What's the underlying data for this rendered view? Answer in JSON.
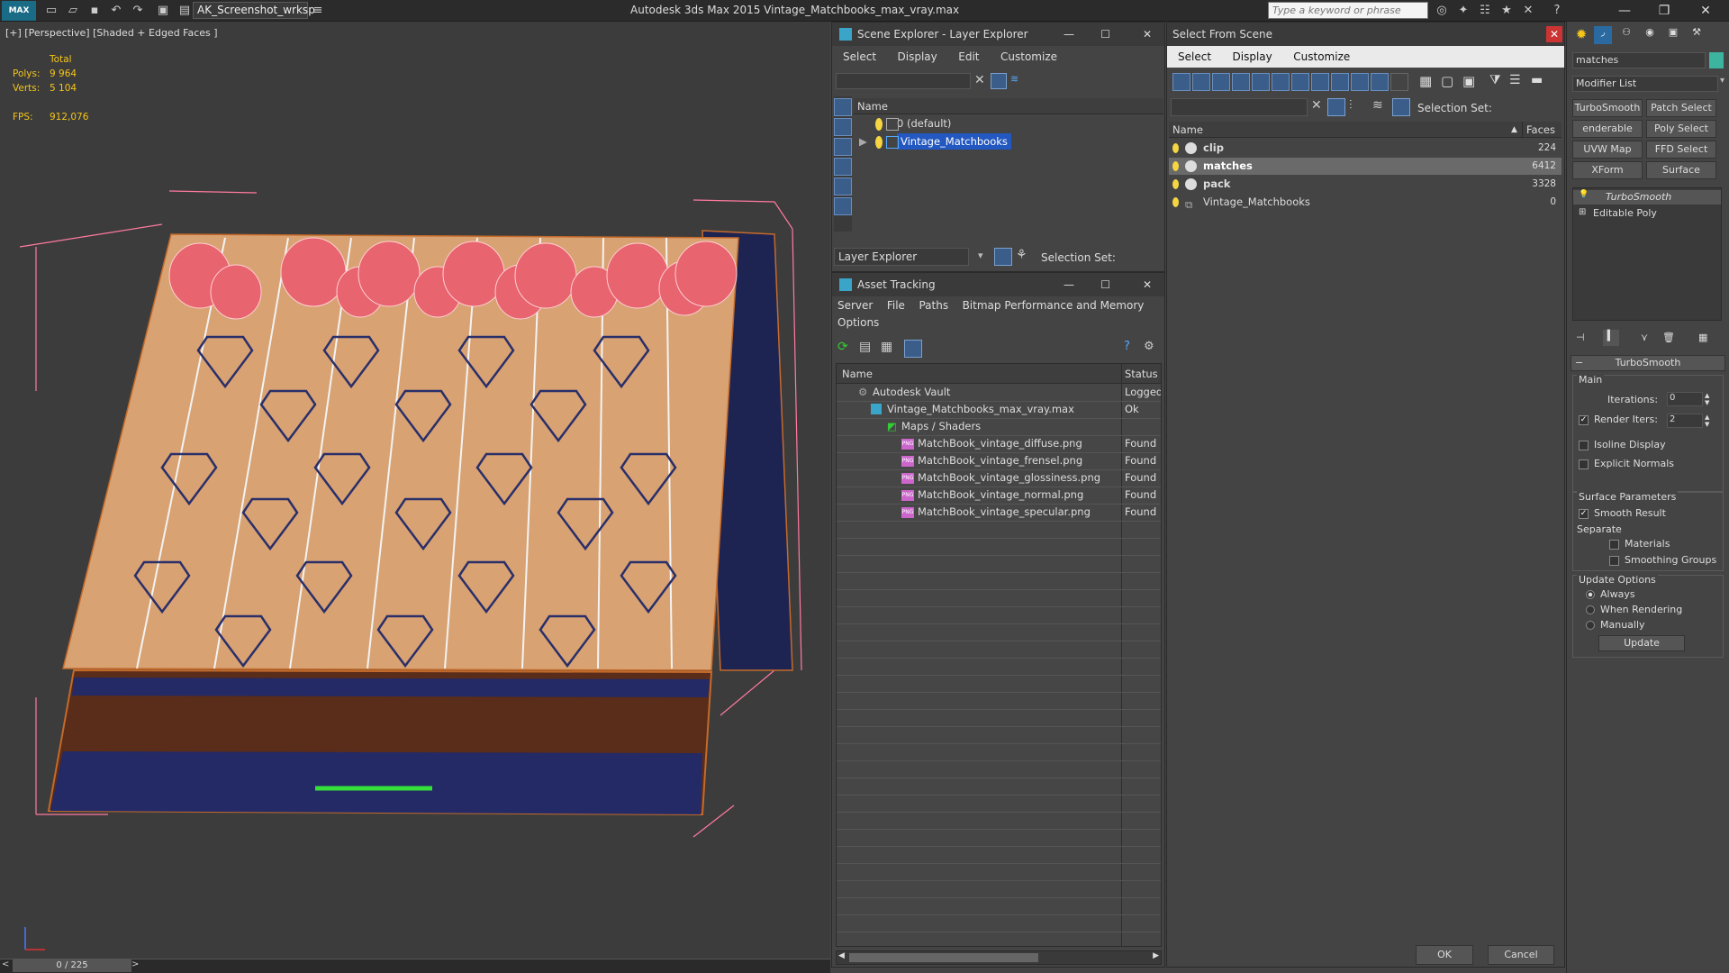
{
  "app": {
    "title": "Autodesk 3ds Max  2015    Vintage_Matchbooks_max_vray.max",
    "workspace": "AK_Screenshot_wrksp",
    "search_placeholder": "Type a keyword or phrase",
    "logo": "MAX"
  },
  "viewport": {
    "label": "[+] [Perspective] [Shaded + Edged Faces ]",
    "stats": {
      "total_label": "Total",
      "polys_label": "Polys:",
      "polys_value": "9 964",
      "verts_label": "Verts:",
      "verts_value": "5 104",
      "fps_label": "FPS:",
      "fps_value": "912,076"
    },
    "timeslider": "0 / 225"
  },
  "scene_explorer": {
    "title": "Scene Explorer - Layer Explorer",
    "menu": [
      "Select",
      "Display",
      "Edit",
      "Customize"
    ],
    "column": "Name",
    "rows": [
      {
        "label": "0 (default)",
        "selected": false
      },
      {
        "label": "Vintage_Matchbooks",
        "selected": true
      }
    ],
    "footer_dropdown": "Layer Explorer",
    "selection_set_label": "Selection Set:"
  },
  "asset_tracking": {
    "title": "Asset Tracking",
    "menu": [
      "Server",
      "File",
      "Paths",
      "Bitmap Performance and Memory"
    ],
    "menu2": [
      "Options"
    ],
    "col_name": "Name",
    "col_status": "Status",
    "rows": [
      {
        "name": "Autodesk Vault",
        "status": "Logged",
        "indent": 0
      },
      {
        "name": "Vintage_Matchbooks_max_vray.max",
        "status": "Ok",
        "indent": 1
      },
      {
        "name": "Maps / Shaders",
        "status": "",
        "indent": 2
      },
      {
        "name": "MatchBook_vintage_diffuse.png",
        "status": "Found",
        "indent": 3
      },
      {
        "name": "MatchBook_vintage_frensel.png",
        "status": "Found",
        "indent": 3
      },
      {
        "name": "MatchBook_vintage_glossiness.png",
        "status": "Found",
        "indent": 3
      },
      {
        "name": "MatchBook_vintage_normal.png",
        "status": "Found",
        "indent": 3
      },
      {
        "name": "MatchBook_vintage_specular.png",
        "status": "Found",
        "indent": 3
      }
    ]
  },
  "select_from_scene": {
    "title": "Select From Scene",
    "menu": [
      "Select",
      "Display",
      "Customize"
    ],
    "selection_set_label": "Selection Set:",
    "col_name": "Name",
    "col_faces": "Faces",
    "rows": [
      {
        "name": "clip",
        "faces": "224",
        "bold": true,
        "selected": false
      },
      {
        "name": "matches",
        "faces": "6412",
        "bold": true,
        "selected": true
      },
      {
        "name": "pack",
        "faces": "3328",
        "bold": true,
        "selected": false
      },
      {
        "name": "Vintage_Matchbooks",
        "faces": "0",
        "bold": false,
        "selected": false
      }
    ],
    "ok": "OK",
    "cancel": "Cancel"
  },
  "command_panel": {
    "object_name": "matches",
    "modifier_list": "Modifier List",
    "buttons": [
      "TurboSmooth",
      "Patch Select",
      "enderable Splin",
      "Poly Select",
      "UVW Map",
      "FFD Select",
      "XForm",
      "Surface Select"
    ],
    "stack": [
      "TurboSmooth",
      "Editable Poly"
    ],
    "rollout_title": "TurboSmooth",
    "main_label": "Main",
    "iterations_label": "Iterations:",
    "iterations_value": "0",
    "render_iters_label": "Render Iters:",
    "render_iters_value": "2",
    "isoline_label": "Isoline Display",
    "explicit_normals_label": "Explicit Normals",
    "surface_params_label": "Surface Parameters",
    "smooth_result_label": "Smooth Result",
    "separate_label": "Separate",
    "materials_label": "Materials",
    "smoothing_groups_label": "Smoothing Groups",
    "update_options_label": "Update Options",
    "always_label": "Always",
    "when_rendering_label": "When Rendering",
    "manually_label": "Manually",
    "update_button": "Update"
  }
}
